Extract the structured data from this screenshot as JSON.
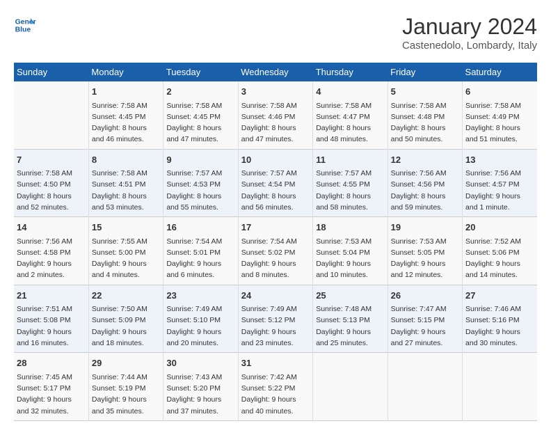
{
  "header": {
    "logo_line1": "General",
    "logo_line2": "Blue",
    "month_title": "January 2024",
    "location": "Castenedolo, Lombardy, Italy"
  },
  "days_of_week": [
    "Sunday",
    "Monday",
    "Tuesday",
    "Wednesday",
    "Thursday",
    "Friday",
    "Saturday"
  ],
  "weeks": [
    [
      {
        "day": null,
        "info": null
      },
      {
        "day": "1",
        "sunrise": "7:58 AM",
        "sunset": "4:45 PM",
        "daylight": "8 hours and 46 minutes."
      },
      {
        "day": "2",
        "sunrise": "7:58 AM",
        "sunset": "4:45 PM",
        "daylight": "8 hours and 47 minutes."
      },
      {
        "day": "3",
        "sunrise": "7:58 AM",
        "sunset": "4:46 PM",
        "daylight": "8 hours and 47 minutes."
      },
      {
        "day": "4",
        "sunrise": "7:58 AM",
        "sunset": "4:47 PM",
        "daylight": "8 hours and 48 minutes."
      },
      {
        "day": "5",
        "sunrise": "7:58 AM",
        "sunset": "4:48 PM",
        "daylight": "8 hours and 50 minutes."
      },
      {
        "day": "6",
        "sunrise": "7:58 AM",
        "sunset": "4:49 PM",
        "daylight": "8 hours and 51 minutes."
      }
    ],
    [
      {
        "day": "7",
        "sunrise": "7:58 AM",
        "sunset": "4:50 PM",
        "daylight": "8 hours and 52 minutes."
      },
      {
        "day": "8",
        "sunrise": "7:58 AM",
        "sunset": "4:51 PM",
        "daylight": "8 hours and 53 minutes."
      },
      {
        "day": "9",
        "sunrise": "7:57 AM",
        "sunset": "4:53 PM",
        "daylight": "8 hours and 55 minutes."
      },
      {
        "day": "10",
        "sunrise": "7:57 AM",
        "sunset": "4:54 PM",
        "daylight": "8 hours and 56 minutes."
      },
      {
        "day": "11",
        "sunrise": "7:57 AM",
        "sunset": "4:55 PM",
        "daylight": "8 hours and 58 minutes."
      },
      {
        "day": "12",
        "sunrise": "7:56 AM",
        "sunset": "4:56 PM",
        "daylight": "8 hours and 59 minutes."
      },
      {
        "day": "13",
        "sunrise": "7:56 AM",
        "sunset": "4:57 PM",
        "daylight": "9 hours and 1 minute."
      }
    ],
    [
      {
        "day": "14",
        "sunrise": "7:56 AM",
        "sunset": "4:58 PM",
        "daylight": "9 hours and 2 minutes."
      },
      {
        "day": "15",
        "sunrise": "7:55 AM",
        "sunset": "5:00 PM",
        "daylight": "9 hours and 4 minutes."
      },
      {
        "day": "16",
        "sunrise": "7:54 AM",
        "sunset": "5:01 PM",
        "daylight": "9 hours and 6 minutes."
      },
      {
        "day": "17",
        "sunrise": "7:54 AM",
        "sunset": "5:02 PM",
        "daylight": "9 hours and 8 minutes."
      },
      {
        "day": "18",
        "sunrise": "7:53 AM",
        "sunset": "5:04 PM",
        "daylight": "9 hours and 10 minutes."
      },
      {
        "day": "19",
        "sunrise": "7:53 AM",
        "sunset": "5:05 PM",
        "daylight": "9 hours and 12 minutes."
      },
      {
        "day": "20",
        "sunrise": "7:52 AM",
        "sunset": "5:06 PM",
        "daylight": "9 hours and 14 minutes."
      }
    ],
    [
      {
        "day": "21",
        "sunrise": "7:51 AM",
        "sunset": "5:08 PM",
        "daylight": "9 hours and 16 minutes."
      },
      {
        "day": "22",
        "sunrise": "7:50 AM",
        "sunset": "5:09 PM",
        "daylight": "9 hours and 18 minutes."
      },
      {
        "day": "23",
        "sunrise": "7:49 AM",
        "sunset": "5:10 PM",
        "daylight": "9 hours and 20 minutes."
      },
      {
        "day": "24",
        "sunrise": "7:49 AM",
        "sunset": "5:12 PM",
        "daylight": "9 hours and 23 minutes."
      },
      {
        "day": "25",
        "sunrise": "7:48 AM",
        "sunset": "5:13 PM",
        "daylight": "9 hours and 25 minutes."
      },
      {
        "day": "26",
        "sunrise": "7:47 AM",
        "sunset": "5:15 PM",
        "daylight": "9 hours and 27 minutes."
      },
      {
        "day": "27",
        "sunrise": "7:46 AM",
        "sunset": "5:16 PM",
        "daylight": "9 hours and 30 minutes."
      }
    ],
    [
      {
        "day": "28",
        "sunrise": "7:45 AM",
        "sunset": "5:17 PM",
        "daylight": "9 hours and 32 minutes."
      },
      {
        "day": "29",
        "sunrise": "7:44 AM",
        "sunset": "5:19 PM",
        "daylight": "9 hours and 35 minutes."
      },
      {
        "day": "30",
        "sunrise": "7:43 AM",
        "sunset": "5:20 PM",
        "daylight": "9 hours and 37 minutes."
      },
      {
        "day": "31",
        "sunrise": "7:42 AM",
        "sunset": "5:22 PM",
        "daylight": "9 hours and 40 minutes."
      },
      {
        "day": null,
        "info": null
      },
      {
        "day": null,
        "info": null
      },
      {
        "day": null,
        "info": null
      }
    ]
  ]
}
